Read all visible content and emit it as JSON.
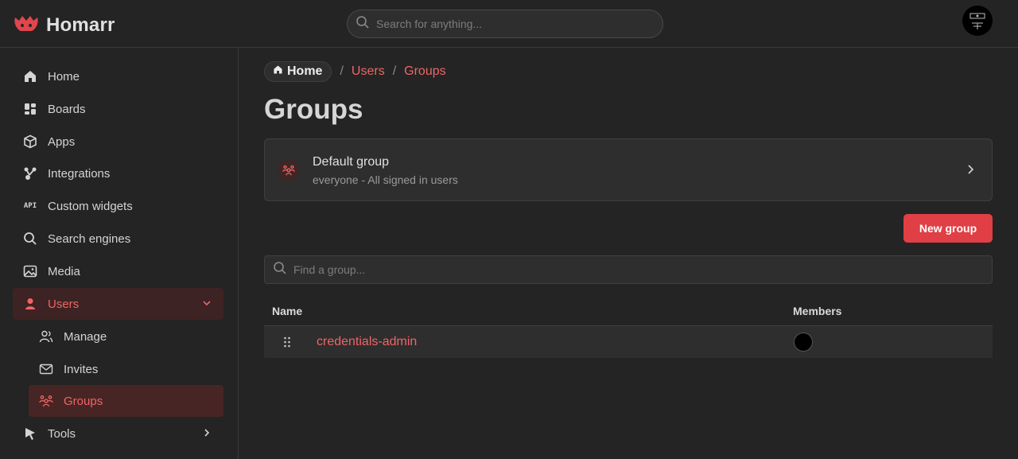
{
  "app": {
    "name": "Homarr"
  },
  "search": {
    "placeholder": "Search for anything..."
  },
  "sidebar": {
    "items": [
      {
        "label": "Home",
        "icon": "home-icon"
      },
      {
        "label": "Boards",
        "icon": "boards-icon"
      },
      {
        "label": "Apps",
        "icon": "apps-icon"
      },
      {
        "label": "Integrations",
        "icon": "integrations-icon"
      },
      {
        "label": "Custom widgets",
        "icon": "api-icon"
      },
      {
        "label": "Search engines",
        "icon": "search-icon"
      },
      {
        "label": "Media",
        "icon": "media-icon"
      },
      {
        "label": "Users",
        "icon": "user-icon",
        "expanded": true,
        "active": true
      },
      {
        "label": "Manage",
        "icon": "users-icon"
      },
      {
        "label": "Invites",
        "icon": "mail-icon"
      },
      {
        "label": "Groups",
        "icon": "groups-icon",
        "active": true
      },
      {
        "label": "Tools",
        "icon": "pointer-icon"
      }
    ]
  },
  "breadcrumb": {
    "home": "Home",
    "users": "Users",
    "groups": "Groups"
  },
  "page": {
    "title": "Groups"
  },
  "default_group": {
    "title": "Default group",
    "subtitle": "everyone - All signed in users"
  },
  "actions": {
    "new_group": "New group"
  },
  "find": {
    "placeholder": "Find a group..."
  },
  "table": {
    "columns": [
      "Name",
      "Members"
    ],
    "rows": [
      {
        "name": "credentials-admin"
      }
    ]
  },
  "colors": {
    "accent": "#f06565",
    "button": "#e03f45",
    "background": "#242424"
  }
}
